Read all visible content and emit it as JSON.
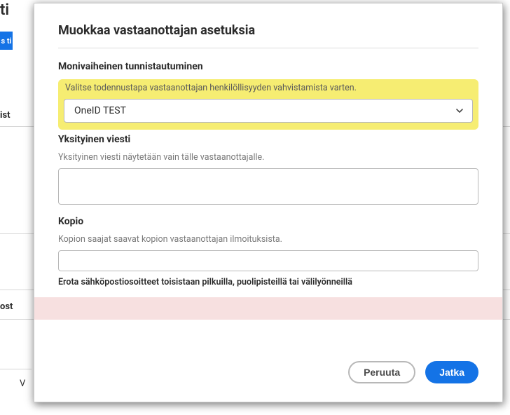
{
  "background": {
    "header_fragment": "ti",
    "blue_tab_fragment": "s ti",
    "left_label_fragment": "ist",
    "ost_fragment": "ost",
    "v_fragment": "V"
  },
  "modal": {
    "title": "Muokkaa vastaanottajan asetuksia",
    "mfa": {
      "heading": "Monivaiheinen tunnistautuminen",
      "help": "Valitse todennustapa vastaanottajan henkilöllisyyden vahvistamista varten.",
      "selected": "OneID TEST"
    },
    "private_message": {
      "heading": "Yksityinen viesti",
      "help": "Yksityinen viesti näytetään vain tälle vastaanottajalle.",
      "value": ""
    },
    "copy": {
      "heading": "Kopio",
      "help": "Kopion saajat saavat kopion vastaanottajan ilmoituksista.",
      "value": "",
      "hint": "Erota sähköpostiosoitteet toisistaan pilkuilla, puolipisteillä tai välilyönneillä"
    },
    "footer": {
      "cancel": "Peruuta",
      "continue": "Jatka"
    }
  }
}
